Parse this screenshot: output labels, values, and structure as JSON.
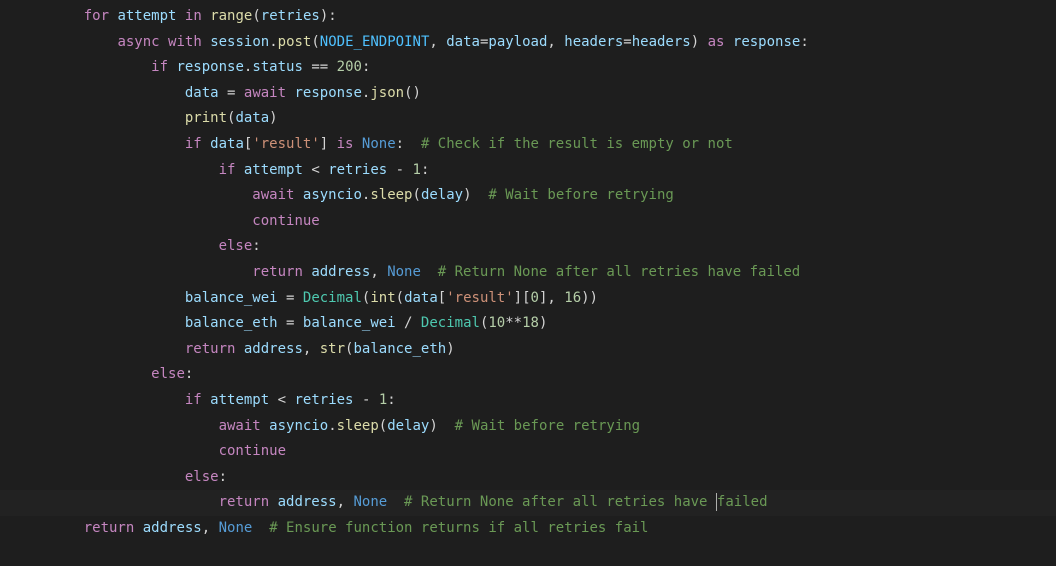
{
  "code": {
    "line1": {
      "kw_for": "for",
      "var_attempt": "attempt",
      "kw_in": "in",
      "fn_range": "range",
      "var_retries": "retries"
    },
    "line2": {
      "kw_async": "async",
      "kw_with": "with",
      "var_session": "session",
      "m_post": "post",
      "c_NODE_ENDPOINT": "NODE_ENDPOINT",
      "p_data": "data",
      "var_payload": "payload",
      "p_headers": "headers",
      "var_headers": "headers",
      "kw_as": "as",
      "var_response": "response"
    },
    "line3": {
      "kw_if": "if",
      "var_response": "response",
      "attr_status": "status",
      "num_200": "200"
    },
    "line4": {
      "var_data": "data",
      "kw_await": "await",
      "var_response": "response",
      "m_json": "json"
    },
    "line5": {
      "fn_print": "print",
      "var_data": "data"
    },
    "line6": {
      "kw_if": "if",
      "var_data": "data",
      "str_result": "'result'",
      "kw_is": "is",
      "c_none": "None",
      "comment": "# Check if the result is empty or not"
    },
    "line7": {
      "kw_if": "if",
      "var_attempt": "attempt",
      "var_retries": "retries",
      "num_1": "1"
    },
    "line8": {
      "kw_await": "await",
      "var_asyncio": "asyncio",
      "m_sleep": "sleep",
      "var_delay": "delay",
      "comment": "# Wait before retrying"
    },
    "line9": {
      "kw_continue": "continue"
    },
    "line10": {
      "kw_else": "else"
    },
    "line11": {
      "kw_return": "return",
      "var_address": "address",
      "c_none": "None",
      "comment": "# Return None after all retries have failed"
    },
    "line12": {
      "var_balance_wei": "balance_wei",
      "cls_decimal": "Decimal",
      "fn_int": "int",
      "var_data": "data",
      "str_result": "'result'",
      "num_0": "0",
      "num_16": "16"
    },
    "line13": {
      "var_balance_eth": "balance_eth",
      "var_balance_wei": "balance_wei",
      "cls_decimal": "Decimal",
      "num_10": "10",
      "num_18": "18"
    },
    "line14": {
      "kw_return": "return",
      "var_address": "address",
      "fn_str": "str",
      "var_balance_eth": "balance_eth"
    },
    "line15": {
      "kw_else": "else"
    },
    "line16": {
      "kw_if": "if",
      "var_attempt": "attempt",
      "var_retries": "retries",
      "num_1": "1"
    },
    "line17": {
      "kw_await": "await",
      "var_asyncio": "asyncio",
      "m_sleep": "sleep",
      "var_delay": "delay",
      "comment": "# Wait before retrying"
    },
    "line18": {
      "kw_continue": "continue"
    },
    "line19": {
      "kw_else": "else"
    },
    "line20": {
      "kw_return": "return",
      "var_address": "address",
      "c_none": "None",
      "comment_a": "# Return None after all retries have ",
      "comment_b": "failed"
    },
    "line21": {
      "kw_return": "return",
      "var_address": "address",
      "c_none": "None",
      "comment": "# Ensure function returns if all retries fail"
    }
  }
}
